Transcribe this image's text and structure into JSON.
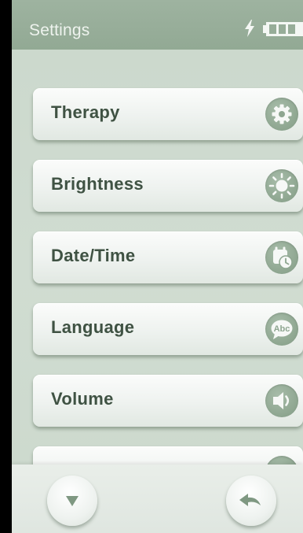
{
  "status_bar": {
    "title": "Settings",
    "charge_icon": "lightning-bolt-icon",
    "battery_icon": "battery-icon"
  },
  "menu": {
    "items": [
      {
        "label": "Therapy",
        "icon": "gear-icon"
      },
      {
        "label": "Brightness",
        "icon": "sun-icon"
      },
      {
        "label": "Date/Time",
        "icon": "calendar-clock-icon"
      },
      {
        "label": "Language",
        "icon": "abc-speech-bubble-icon",
        "icon_text": "Abc"
      },
      {
        "label": "Volume",
        "icon": "speaker-icon"
      },
      {
        "label": "",
        "icon": ""
      }
    ]
  },
  "bottom_bar": {
    "scroll_down_icon": "triangle-down-icon",
    "back_icon": "back-arrow-icon"
  },
  "colors": {
    "screen_bg": "#cfdbd0",
    "status_bar_bg": "#97ad99",
    "label_text": "#3f5243",
    "icon_circle": "#8ea690",
    "button_face": "#f4f7f4"
  }
}
